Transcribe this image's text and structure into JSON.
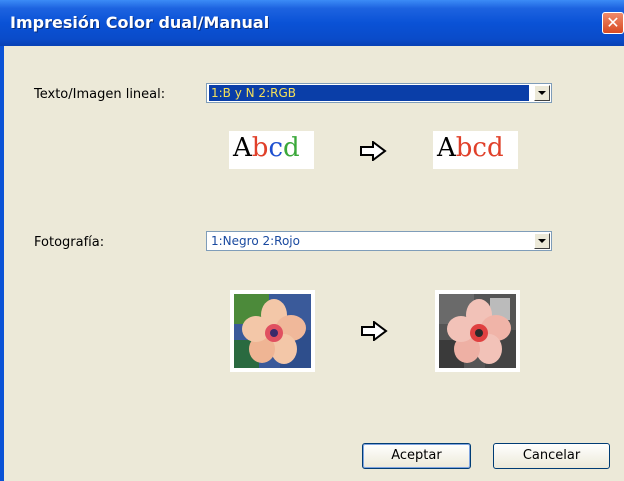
{
  "window": {
    "title": "Impresión Color dual/Manual"
  },
  "text_section": {
    "label": "Texto/Imagen lineal:",
    "selected_option": "1:B y N 2:RGB",
    "sample_before": {
      "a": "A",
      "b": "b",
      "c": "c",
      "d": "d"
    },
    "sample_after": {
      "a": "A",
      "bcd": "bcd"
    }
  },
  "photo_section": {
    "label": "Fotografía:",
    "selected_option": "1:Negro 2:Rojo"
  },
  "buttons": {
    "ok": "Aceptar",
    "cancel": "Cancelar"
  },
  "icons": {
    "close": "close-icon",
    "dropdown": "chevron-down-icon",
    "arrow": "right-arrow-icon"
  },
  "colors": {
    "title_bar": "#0a52d6",
    "dialog_bg": "#ece9d8",
    "selection_bg": "#0a3ea8",
    "selection_text": "#f5e05a",
    "red_sample": "#e0402a",
    "blue_sample": "#1d4fd0",
    "green_sample": "#3aa83a"
  }
}
